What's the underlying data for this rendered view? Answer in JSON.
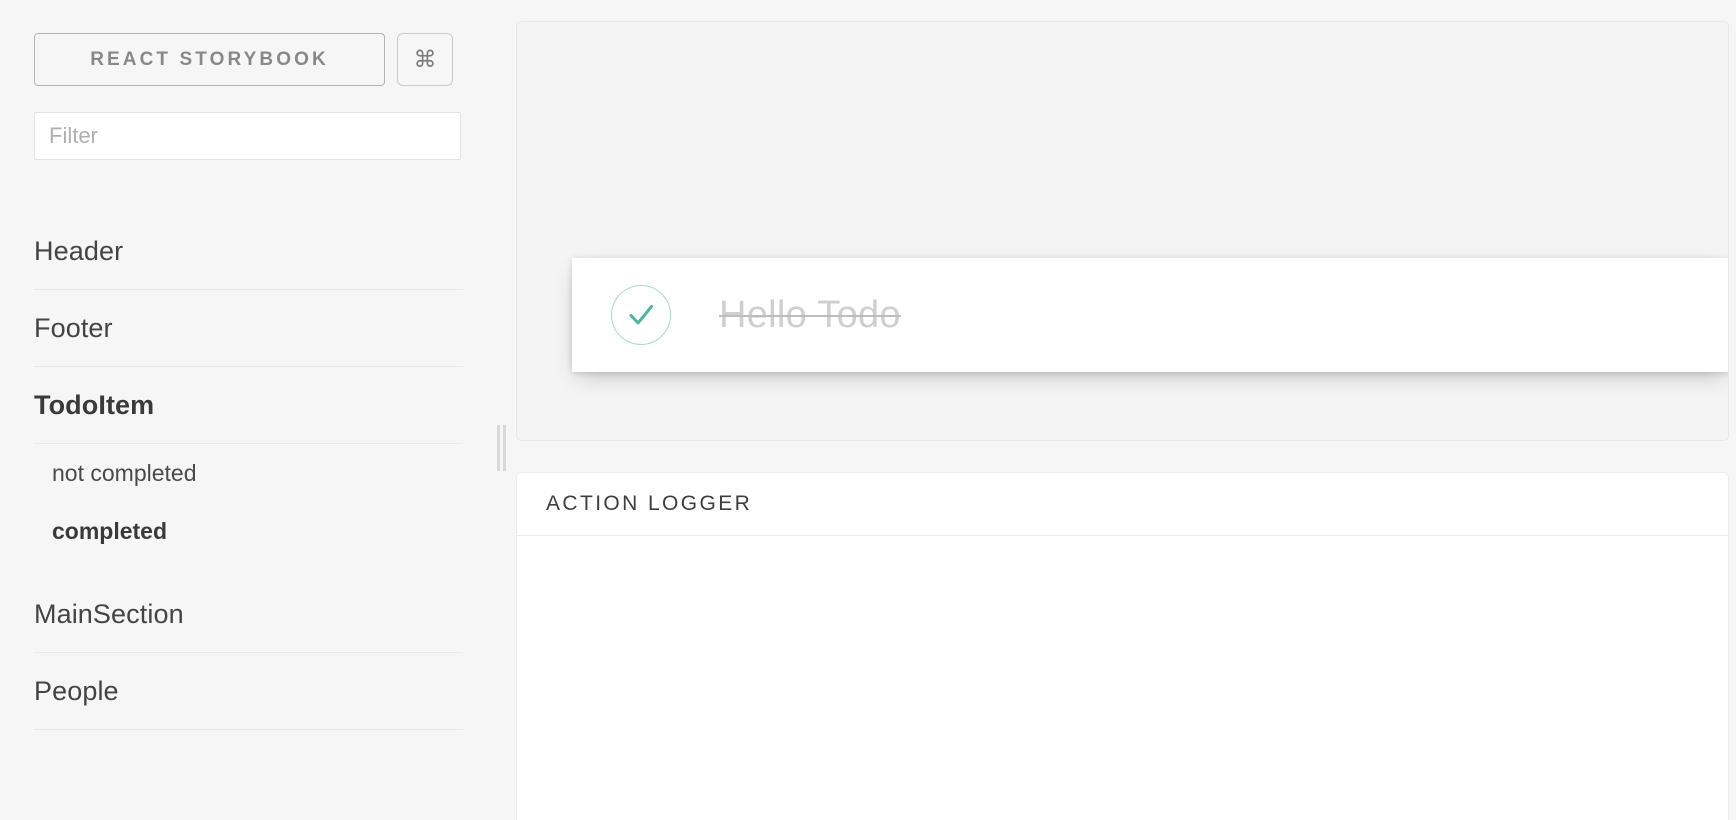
{
  "app": {
    "brand_label": "REACT STORYBOOK",
    "shortcut_icon": "command-icon",
    "shortcut_glyph": "⌘"
  },
  "sidebar": {
    "filter": {
      "value": "",
      "placeholder": "Filter"
    },
    "kinds": [
      {
        "name": "Header",
        "open": false,
        "stories": []
      },
      {
        "name": "Footer",
        "open": false,
        "stories": []
      },
      {
        "name": "TodoItem",
        "open": true,
        "stories": [
          {
            "name": "not completed",
            "selected": false
          },
          {
            "name": "completed",
            "selected": true
          }
        ]
      },
      {
        "name": "MainSection",
        "open": false,
        "stories": []
      },
      {
        "name": "People",
        "open": false,
        "stories": []
      }
    ]
  },
  "preview": {
    "todo": {
      "label": "Hello Todo",
      "completed": true,
      "checkbox_icon": "check-icon",
      "check_color": "#4db6a1",
      "circle_color": "#a9d8cd",
      "label_color": "#cfcfcf"
    }
  },
  "action_logger": {
    "title": "ACTION LOGGER",
    "entries": []
  },
  "resizers": {
    "vertical": "vertical-resize-handle",
    "horizontal": "horizontal-resize-handle"
  },
  "colors": {
    "page_background": "#f6f6f6",
    "panel_background": "#f4f4f4",
    "card_background": "#ffffff",
    "border": "#e8e8e8",
    "text": "#444444",
    "muted_text": "#b0b0b0",
    "accent": "#4db6a1"
  }
}
